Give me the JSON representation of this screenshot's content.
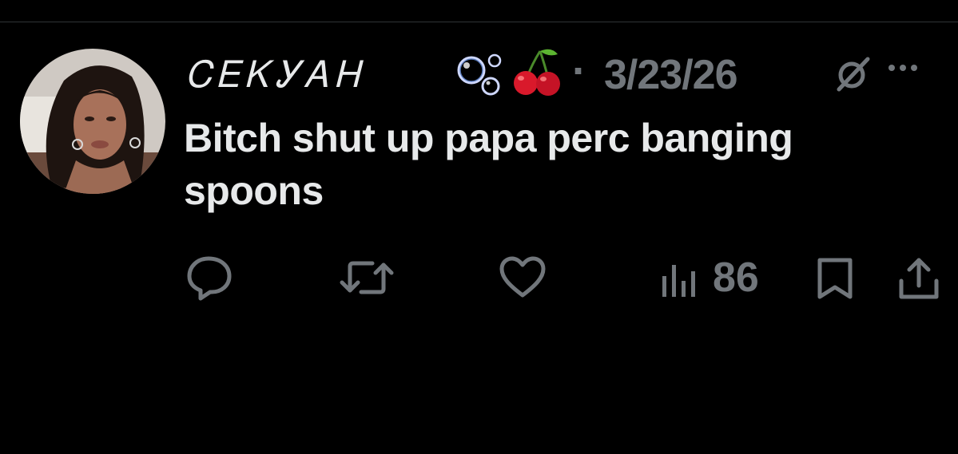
{
  "tweet": {
    "author": {
      "display_name": "ᏟᎬᏦᎩᎪᎻ",
      "avatar_icon": "profile-photo",
      "emoji": [
        "bubbles-icon",
        "cherries-icon"
      ]
    },
    "separator": "·",
    "date": "3/23/26",
    "text": "Bitch shut up papa perc banging spoons",
    "actions": {
      "reply_icon": "reply-icon",
      "retweet_icon": "retweet-icon",
      "like_icon": "heart-icon",
      "views_icon": "analytics-icon",
      "views_count": "86",
      "bookmark_icon": "bookmark-icon",
      "share_icon": "share-icon"
    },
    "colors": {
      "background": "#000000",
      "text": "#e7e9ea",
      "muted": "#71767b",
      "divider": "#2f3336"
    }
  }
}
